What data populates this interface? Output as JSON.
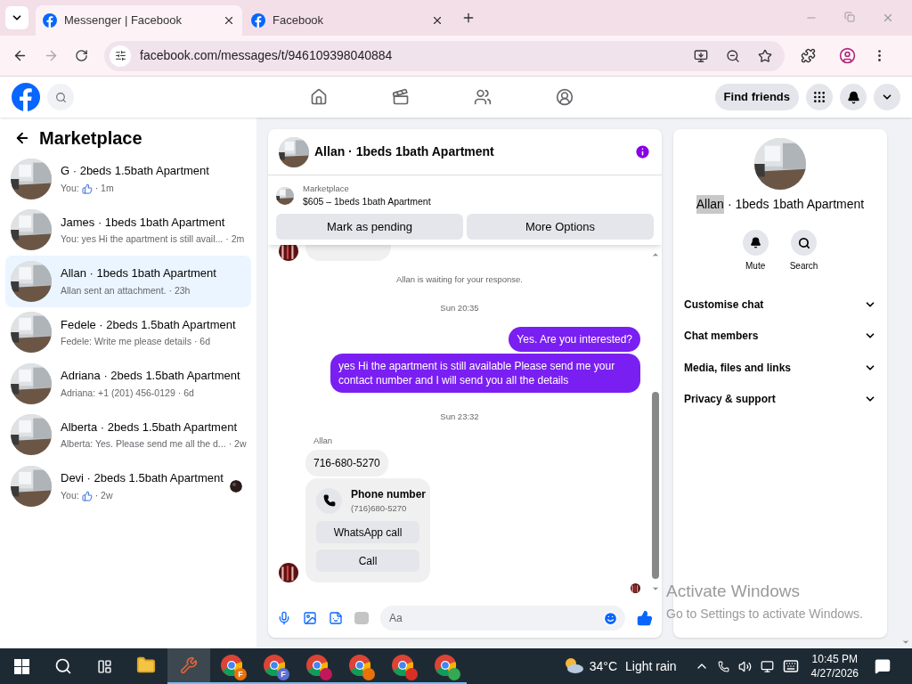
{
  "browser": {
    "tabs": [
      {
        "title": "Messenger | Facebook",
        "selected": true
      },
      {
        "title": "Facebook",
        "selected": false
      }
    ],
    "url": "facebook.com/messages/t/946109398040884"
  },
  "header": {
    "find_friends": "Find friends"
  },
  "sidebar": {
    "title": "Marketplace",
    "conversations": [
      {
        "title": "G · 2beds 1.5bath Apartment",
        "kind": "like",
        "preview": "You:",
        "time": "· 1m",
        "selected": false,
        "seen": false
      },
      {
        "title": "James · 1beds 1bath Apartment",
        "kind": "text",
        "preview": "You: yes Hi the apartment is still avail...",
        "time": "· 2m",
        "selected": false,
        "seen": false
      },
      {
        "title": "Allan · 1beds 1bath Apartment",
        "kind": "text",
        "preview": "Allan sent an attachment.",
        "time": "· 23h",
        "selected": true,
        "seen": false
      },
      {
        "title": "Fedele · 2beds 1.5bath Apartment",
        "kind": "text",
        "preview": "Fedele: Write me please details",
        "time": "· 6d",
        "selected": false,
        "seen": false
      },
      {
        "title": "Adriana · 2beds 1.5bath Apartment",
        "kind": "text",
        "preview": "Adriana: +1 (201) 456-0129",
        "time": "· 6d",
        "selected": false,
        "seen": false
      },
      {
        "title": "Alberta · 2beds 1.5bath Apartment",
        "kind": "text",
        "preview": "Alberta: Yes. Please send me all the d...",
        "time": "· 2w",
        "selected": false,
        "seen": false
      },
      {
        "title": "Devi · 2beds 1.5bath Apartment",
        "kind": "like",
        "preview": "You:",
        "time": "· 2w",
        "selected": false,
        "seen": true
      }
    ]
  },
  "chat": {
    "title": "Allan · 1beds 1bath Apartment",
    "listing": {
      "source": "Marketplace",
      "detail": "$605 – 1beds 1bath Apartment"
    },
    "buttons": [
      "Mark as pending",
      "More Options"
    ],
    "messages": [
      {
        "kind": "hidden_incoming"
      },
      {
        "kind": "notice",
        "text": "Allan is waiting for your response."
      },
      {
        "kind": "timestamp",
        "text": "Sun 20:35"
      },
      {
        "kind": "outgoing",
        "text": "Yes. Are you interested?"
      },
      {
        "kind": "outgoing",
        "text": "yes Hi the apartment is still available Please send me your contact number and I will send you all the details"
      },
      {
        "kind": "timestamp",
        "text": "Sun 23:32"
      },
      {
        "kind": "sender",
        "text": "Allan"
      },
      {
        "kind": "incoming",
        "text": "716-680-5270"
      },
      {
        "kind": "contact_card",
        "title": "Phone number",
        "number": "(716)680-5270",
        "actions": [
          "WhatsApp call",
          "Call"
        ]
      }
    ],
    "composer": {
      "placeholder": "Aa"
    }
  },
  "info": {
    "highlight": "Allan",
    "title_rest": "· 1beds 1bath Apartment",
    "actions": [
      {
        "kind": "mute",
        "label": "Mute"
      },
      {
        "kind": "search",
        "label": "Search"
      }
    ],
    "sections": [
      {
        "label": "Customise chat",
        "expanded": false
      },
      {
        "label": "Chat members",
        "expanded": false
      },
      {
        "label": "Media, files and links",
        "expanded": false
      },
      {
        "label": "Privacy & support",
        "expanded": false
      }
    ]
  },
  "watermark_os": {
    "title": "Activate Windows",
    "subtitle": "Go to Settings to activate Windows."
  },
  "taskbar": {
    "apps": [
      {
        "kind": "folder"
      },
      {
        "kind": "tool",
        "selected": true
      },
      {
        "kind": "chrome",
        "badge": "F",
        "color": "#e8710a"
      },
      {
        "kind": "chrome",
        "badge": "F",
        "color": "#5b6fd6"
      },
      {
        "kind": "chrome",
        "color": "#c2185b"
      },
      {
        "kind": "chrome",
        "color": "#e8710a"
      },
      {
        "kind": "chrome",
        "color": "#d93025"
      },
      {
        "kind": "chrome",
        "color": "#34a853"
      }
    ],
    "temperature": "34°C",
    "weather": "Light rain",
    "time": "10:45 PM",
    "date": "4/27/2026"
  }
}
